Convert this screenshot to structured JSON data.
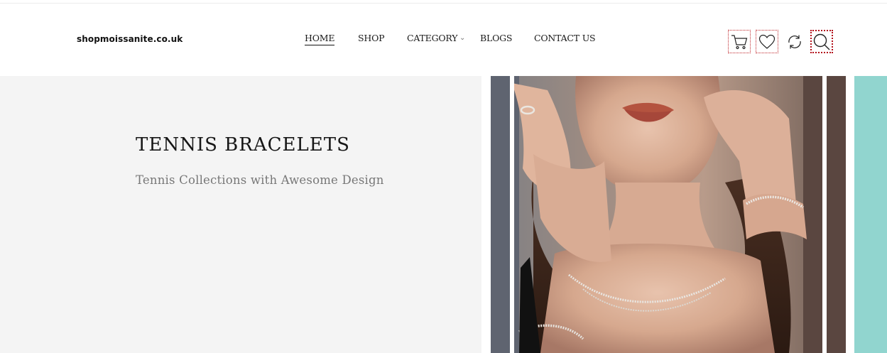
{
  "header": {
    "logo": "shopmoissanite.co.uk",
    "nav": [
      {
        "label": "HOME",
        "active": true
      },
      {
        "label": "SHOP",
        "active": false
      },
      {
        "label": "CATEGORY",
        "active": false,
        "has_dropdown": true
      },
      {
        "label": "BLOGS",
        "active": false
      },
      {
        "label": "CONTACT US",
        "active": false
      }
    ],
    "icons": [
      "cart-icon",
      "heart-icon",
      "refresh-icon",
      "search-icon"
    ]
  },
  "hero": {
    "title": "TENNIS BRACELETS",
    "subtitle": "Tennis Collections with Awesome Design",
    "image_subject": "woman-wearing-tennis-bracelets-and-necklace"
  },
  "colors": {
    "hero_bg": "#f4f4f4",
    "accent_teal": "#91d5cf",
    "focus_outline": "#c0262b",
    "text_dark": "#161616",
    "text_muted": "#777777"
  }
}
